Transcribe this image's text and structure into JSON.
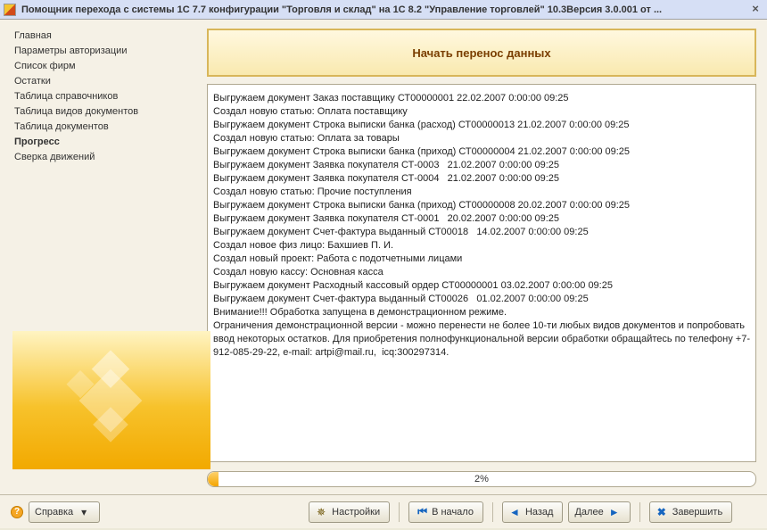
{
  "window": {
    "title": "Помощник перехода с системы 1С 7.7 конфигурации \"Торговля и склад\" на 1С 8.2 \"Управление торговлей\" 10.3Версия 3.0.001 от ..."
  },
  "sidebar": {
    "items": [
      {
        "label": "Главная"
      },
      {
        "label": "Параметры авторизации"
      },
      {
        "label": "Список фирм"
      },
      {
        "label": "Остатки"
      },
      {
        "label": "Таблица справочников"
      },
      {
        "label": "Таблица видов документов"
      },
      {
        "label": "Таблица документов"
      },
      {
        "label": "Прогресс",
        "active": true
      },
      {
        "label": "Сверка движений"
      }
    ]
  },
  "main": {
    "start_button": "Начать перенос данных",
    "log": [
      "Выгружаем документ Заказ поставщику СТ00000001 22.02.2007 0:00:00 09:25",
      "Создал новую статью: Оплата поставщику",
      "Выгружаем документ Строка выписки банка (расход) СТ00000013 21.02.2007 0:00:00 09:25",
      "Создал новую статью: Оплата за товары",
      "Выгружаем документ Строка выписки банка (приход) СТ00000004 21.02.2007 0:00:00 09:25",
      "Выгружаем документ Заявка покупателя СТ-0003   21.02.2007 0:00:00 09:25",
      "Выгружаем документ Заявка покупателя СТ-0004   21.02.2007 0:00:00 09:25",
      "Создал новую статью: Прочие поступления",
      "Выгружаем документ Строка выписки банка (приход) СТ00000008 20.02.2007 0:00:00 09:25",
      "Выгружаем документ Заявка покупателя СТ-0001   20.02.2007 0:00:00 09:25",
      "Выгружаем документ Счет-фактура выданный СТ00018   14.02.2007 0:00:00 09:25",
      "Создал новое физ лицо: Бахшиев П. И.",
      "Создал новый проект: Работа с подотчетными лицами",
      "Создал новую кассу: Основная касса",
      "Выгружаем документ Расходный кассовый ордер СТ00000001 03.02.2007 0:00:00 09:25",
      "Выгружаем документ Счет-фактура выданный СТ00026   01.02.2007 0:00:00 09:25",
      "Внимание!!! Обработка запущена в демонстрационном режиме.",
      "Ограничения демонстрационной версии - можно перенести не более 10-ти любых видов документов и попробовать ввод некоторых остатков. Для приобретения полнофункциональной версии обработки обращайтесь по телефону +7-912-085-29-22, e-mail: artpi@mail.ru,  icq:300297314."
    ],
    "progress_percent": "2%",
    "progress_value": 2
  },
  "buttons": {
    "help": "Справка",
    "settings": "Настройки",
    "start": "В начало",
    "back": "Назад",
    "next": "Далее",
    "finish": "Завершить"
  }
}
